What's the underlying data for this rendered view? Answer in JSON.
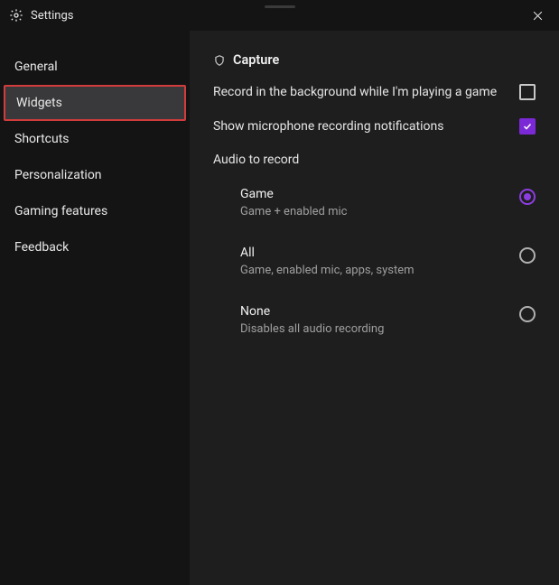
{
  "titlebar": {
    "title": "Settings"
  },
  "sidebar": {
    "items": [
      {
        "label": "General",
        "active": false
      },
      {
        "label": "Widgets",
        "active": true
      },
      {
        "label": "Shortcuts",
        "active": false
      },
      {
        "label": "Personalization",
        "active": false
      },
      {
        "label": "Gaming features",
        "active": false
      },
      {
        "label": "Feedback",
        "active": false
      }
    ]
  },
  "accent_color": "#7b29d6",
  "content": {
    "section_title": "Capture",
    "settings": {
      "record_bg": {
        "label": "Record in the background while I'm playing a game",
        "checked": false
      },
      "mic_notify": {
        "label": "Show microphone recording notifications",
        "checked": true
      }
    },
    "audio": {
      "subheader": "Audio to record",
      "options": [
        {
          "title": "Game",
          "desc": "Game + enabled mic",
          "selected": true
        },
        {
          "title": "All",
          "desc": "Game, enabled mic, apps, system",
          "selected": false
        },
        {
          "title": "None",
          "desc": "Disables all audio recording",
          "selected": false
        }
      ]
    }
  }
}
